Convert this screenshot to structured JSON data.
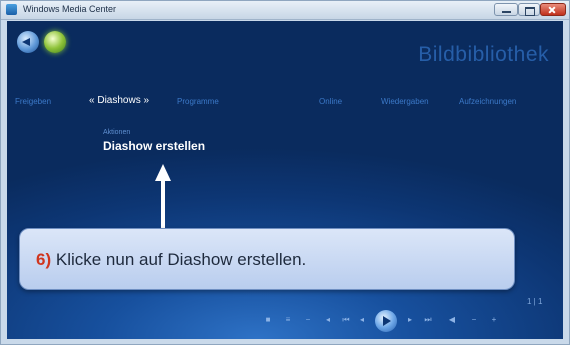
{
  "window": {
    "title": "Windows Media Center"
  },
  "header": {
    "page_title": "Bildbibliothek"
  },
  "nav": {
    "items": [
      "Freigeben",
      "Diashows",
      "Programme",
      "Online",
      "Wiedergaben",
      "Aufzeichnungen"
    ],
    "active_index": 1
  },
  "menu": {
    "subtitle": "Aktionen",
    "main_item": "Diashow erstellen"
  },
  "callout": {
    "step_number": "6)",
    "text": "Klicke nun auf Diashow erstellen."
  },
  "footer": {
    "page_count": "1 | 1"
  },
  "icons": {
    "back": "back-arrow-icon",
    "start": "windows-start-icon",
    "play": "play-icon"
  }
}
